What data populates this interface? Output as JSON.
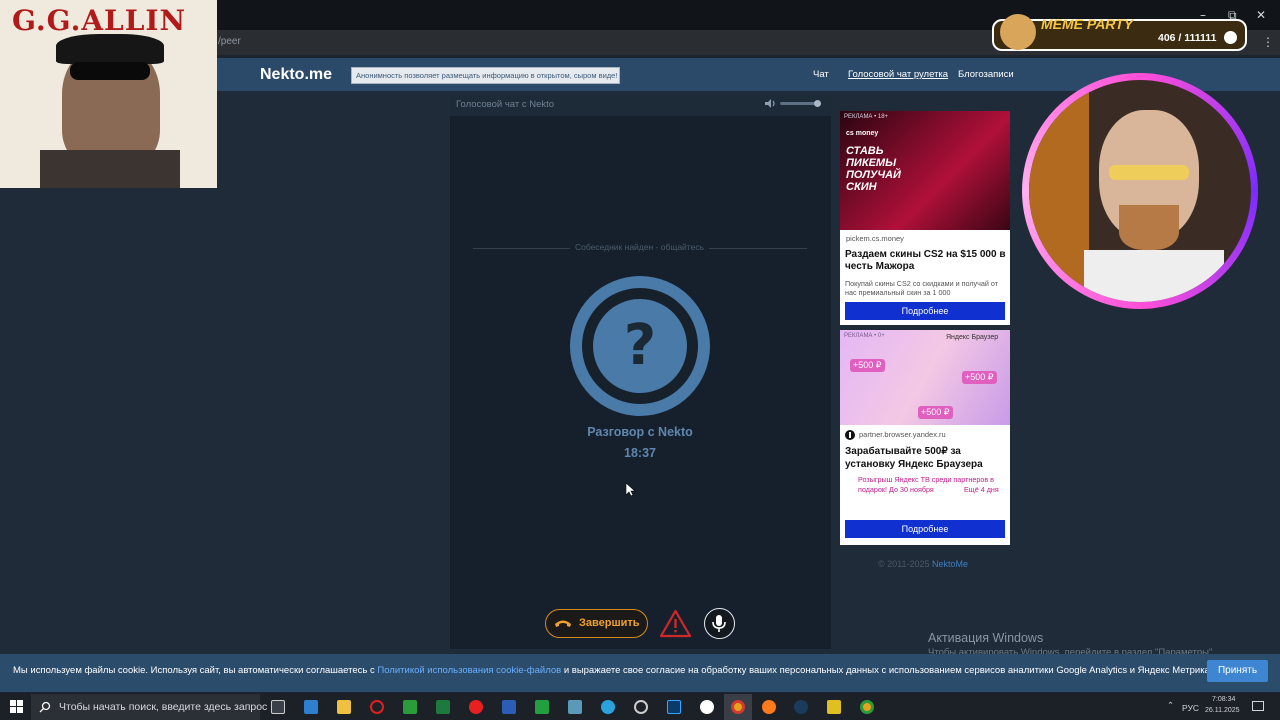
{
  "browser": {
    "url": "/peer",
    "window_controls": {
      "minimize": "–",
      "maximize": "⧉",
      "close": "✕"
    }
  },
  "site": {
    "logo": "Nekto.me",
    "slogan": "Анонимность позволяет размещать информацию в открытом, сыром виде!",
    "nav": [
      "Чат",
      "Голосовой чат рулетка",
      "Блогозаписи"
    ]
  },
  "voice_chat": {
    "title": "Голосовой чат с Nekto",
    "status": "Собеседник найден - общайтесь",
    "avatar_symbol": "?",
    "conversation_label": "Разговор с Nekto",
    "timer": "18:37",
    "end_button": "Завершить",
    "volume_level": 0.9
  },
  "ads": [
    {
      "tag": "РЕКЛАМА • 18+",
      "brand": "cs money",
      "image_text": "СТАВЬ ПИКЕМЫ ПОЛУЧАЙ СКИН",
      "domain": "pickem.cs.money",
      "headline": "Раздаем скины CS2 на $15 000 в честь Мажора",
      "body": "Покупай скины CS2 со скидками и получай от нас премиальный скин за 1 000",
      "button": "Подробнее"
    },
    {
      "tag": "РЕКЛАМА • 0+",
      "brand": "Яндекс Браузер",
      "bonus_1": "+500 ₽",
      "bonus_2": "+500 ₽",
      "bonus_3": "+500 ₽",
      "domain": "partner.browser.yandex.ru",
      "headline": "Зарабатывайте 500₽ за установку Яндекс Браузера",
      "body": "Розыгрыш Яндекс ТВ среди партнеров в подарок! До 30 ноября",
      "deadline": "Ещё 4 дня",
      "button": "Подробнее"
    }
  ],
  "footer": {
    "copyright": "© 2011-2025",
    "link": "NektoMe"
  },
  "windows_activation": {
    "title": "Активация Windows",
    "subtitle": "Чтобы активировать Windows, перейдите в раздел \"Параметры\"."
  },
  "cookie": {
    "text_before": "Мы используем файлы cookie. Используя сайт, вы автоматически соглашаетесь с ",
    "link": "Политикой использования cookie-файлов",
    "text_after": " и выражаете свое согласие на обработку ваших персональных данных с использованием сервисов аналитики Google Analytics и Яндекс Метрика.",
    "accept": "Принять"
  },
  "taskbar": {
    "search_placeholder": "Чтобы начать поиск, введите здесь запрос",
    "language": "РУС",
    "time": "7:08:34",
    "date": "26.11.2025"
  },
  "stream_overlay": {
    "poster_title": "G.G.ALLIN",
    "meme_party_label": "MEME PARTY",
    "meme_party_count": "406 / 111111"
  },
  "colors": {
    "header": "#2b4a69",
    "background": "#1f2b38",
    "panel": "#15202c",
    "accent": "#4a7aa7",
    "end_call": "#f0a030",
    "warning": "#d02828",
    "ad_button": "#1030d0",
    "cookie_bar": "#2c4c6c",
    "accept": "#3f86d2"
  }
}
